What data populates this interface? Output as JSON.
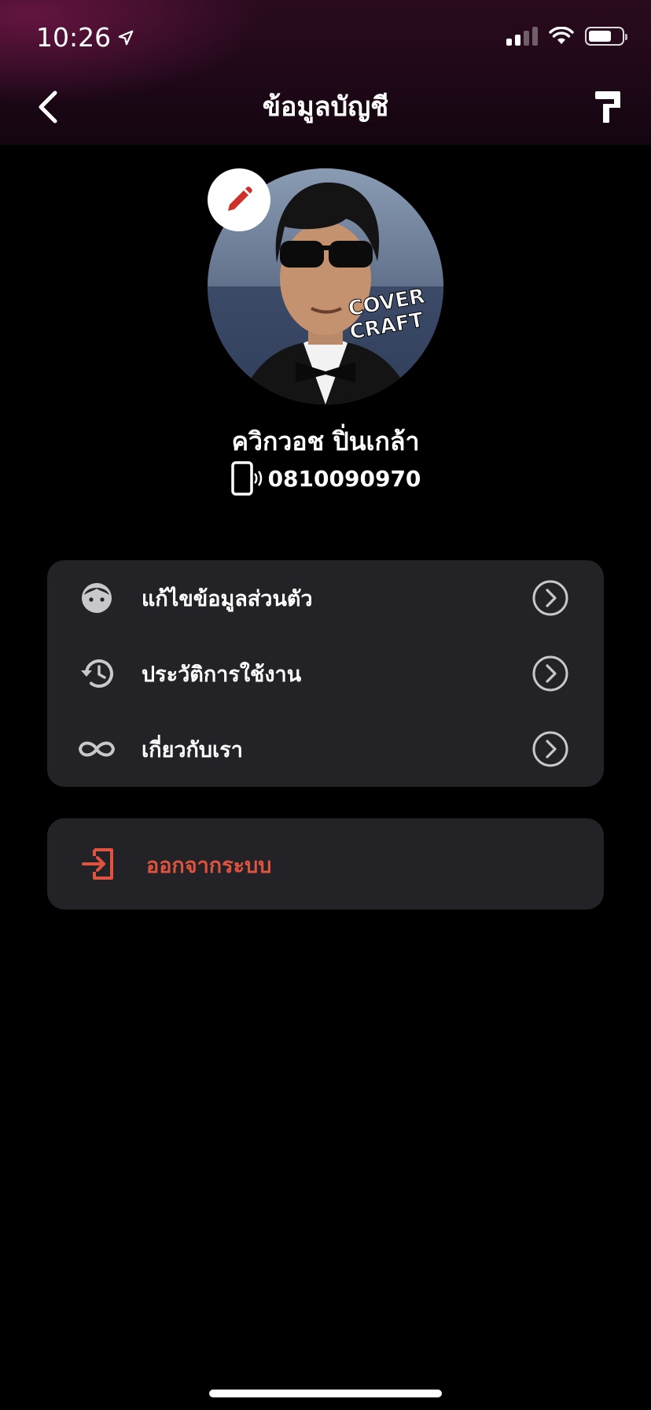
{
  "status_bar": {
    "time": "10:26",
    "location_icon": "location-arrow-icon",
    "signal_icon": "cellular-signal-icon",
    "wifi_icon": "wifi-icon",
    "battery_icon": "battery-icon"
  },
  "nav": {
    "title": "ข้อมูลบัญชี",
    "back_icon": "chevron-left-icon",
    "theme_icon": "paint-roller-icon"
  },
  "profile": {
    "name": "ควิกวอช ปิ่นเกล้า",
    "phone": "0810090970",
    "phone_icon": "mobile-phone-icon",
    "edit_icon": "pencil-icon",
    "avatar_caption_line1": "COVER",
    "avatar_caption_line2": "CRAFT"
  },
  "menu": {
    "items": [
      {
        "label": "แก้ไขข้อมูลส่วนตัว",
        "icon": "face-icon"
      },
      {
        "label": "ประวัติการใช้งาน",
        "icon": "history-icon"
      },
      {
        "label": "เกี่ยวกับเรา",
        "icon": "infinity-icon"
      }
    ]
  },
  "logout": {
    "label": "ออกจากระบบ",
    "icon": "logout-icon"
  },
  "colors": {
    "accent": "#e0533f",
    "card": "#232226",
    "background": "#000000"
  }
}
